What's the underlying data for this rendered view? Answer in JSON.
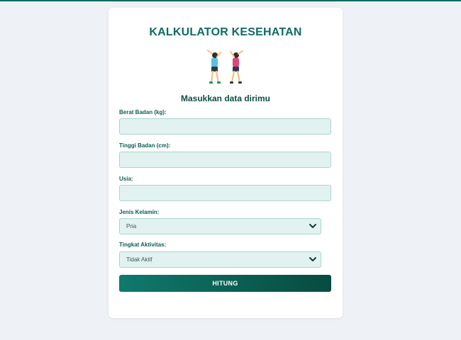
{
  "header": {
    "title": "KALKULATOR KESEHATAN",
    "subtitle": "Masukkan data dirimu"
  },
  "illustration": {
    "icon": "exercising-people-icon"
  },
  "form": {
    "weight": {
      "label": "Berat Badan (kg):",
      "value": ""
    },
    "height": {
      "label": "Tinggi Badan (cm):",
      "value": ""
    },
    "age": {
      "label": "Usia:",
      "value": ""
    },
    "gender": {
      "label": "Jenis Kelamin:",
      "selected": "Pria"
    },
    "activity": {
      "label": "Tingkat Aktivitas:",
      "selected": "Tidak Aktif"
    },
    "submit_label": "HITUNG"
  },
  "colors": {
    "accent": "#0f6b63",
    "input_bg": "#e2f2f0",
    "background": "#eef2f7"
  }
}
